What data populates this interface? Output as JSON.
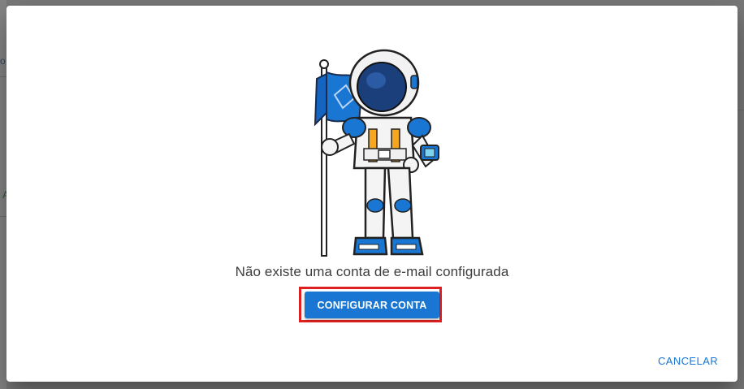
{
  "dialog": {
    "message": "Não existe uma conta de e-mail configurada",
    "primary_button_label": "CONFIGURAR CONTA",
    "cancel_button_label": "CANCELAR"
  },
  "background": {
    "partial_text_top": "o",
    "partial_text_left": "A"
  },
  "colors": {
    "primary": "#1976d2",
    "highlight": "#e02020",
    "overlay": "#7a7a7a",
    "astronaut_blue": "#1565c0",
    "astronaut_orange": "#f5a623"
  },
  "illustration": {
    "icon": "astronaut-with-flag"
  }
}
